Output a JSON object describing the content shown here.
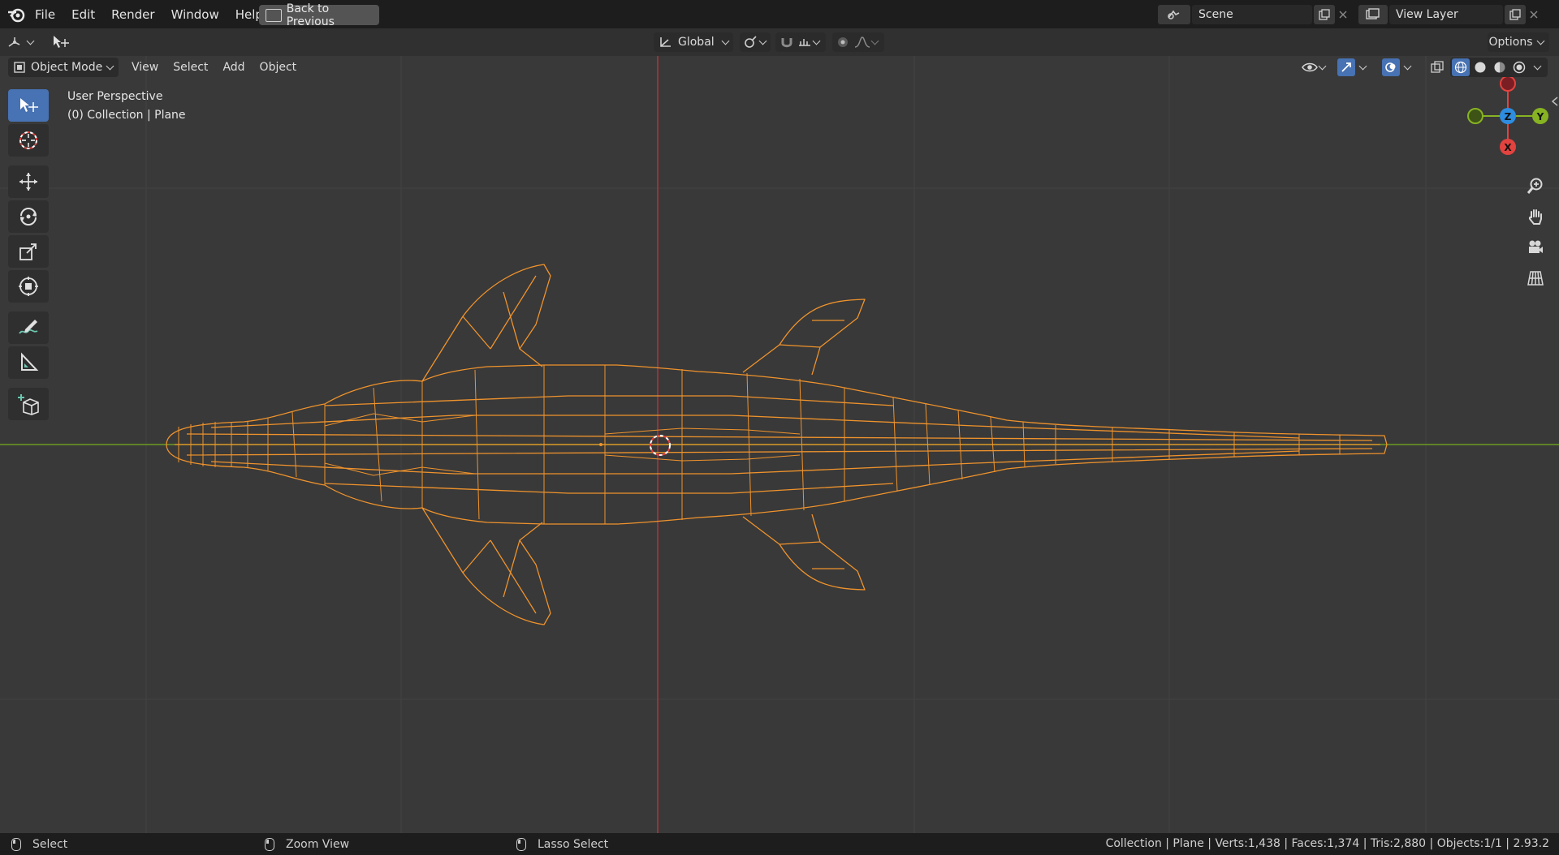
{
  "topbar": {
    "menu": [
      "File",
      "Edit",
      "Render",
      "Window",
      "Help"
    ],
    "back_button": "Back to Previous",
    "scene": "Scene",
    "view_layer": "View Layer"
  },
  "header": {
    "transform_orientation": "Global",
    "options": "Options",
    "mode": "Object Mode",
    "menus": [
      "View",
      "Select",
      "Add",
      "Object"
    ]
  },
  "viewport": {
    "perspective": "User Perspective",
    "collection": "(0) Collection | Plane",
    "gizmo_labels": {
      "z": "Z",
      "y": "Y",
      "x": "X"
    },
    "colors": {
      "accent": "#4772b3",
      "mesh": "#f0932c",
      "x_axis": "#e2433f",
      "y_axis": "#87b323",
      "z_axis": "#2e8de0"
    }
  },
  "statusbar": {
    "select": "Select",
    "zoom": "Zoom View",
    "lasso": "Lasso Select",
    "stats": "Collection | Plane | Verts:1,438 | Faces:1,374 | Tris:2,880 | Objects:1/1 | 2.93.2"
  }
}
